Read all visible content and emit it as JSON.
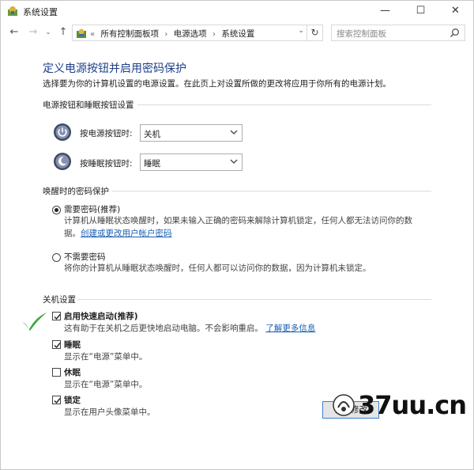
{
  "window": {
    "title": "系统设置",
    "controls": {
      "minimize": "—",
      "maximize": "☐",
      "close": "✕"
    }
  },
  "nav": {
    "back": "←",
    "forward": "→",
    "recent": "⌄",
    "up": "↑",
    "breadcrumb_prefix": "«",
    "breadcrumbs": [
      "所有控制面板项",
      "电源选项",
      "系统设置"
    ],
    "refresh": "↻",
    "search_placeholder": "搜索控制面板"
  },
  "page": {
    "title": "定义电源按钮并启用密码保护",
    "intro": "选择要为你的计算机设置的电源设置。在此页上对设置所做的更改将应用于你所有的电源计划。"
  },
  "power_buttons": {
    "group_title": "电源按钮和睡眠按钮设置",
    "power_button": {
      "label": "按电源按钮时:",
      "value": "关机"
    },
    "sleep_button": {
      "label": "按睡眠按钮时:",
      "value": "睡眠"
    }
  },
  "wake_password": {
    "group_title": "唤醒时的密码保护",
    "require": {
      "label": "需要密码(推荐)",
      "selected": true,
      "desc_line1": "计算机从睡眠状态唤醒时，如果未输入正确的密码来解除计算机锁定，任何人都无法访问你的数",
      "desc_line2": "据。",
      "link": "创建或更改用户帐户密码"
    },
    "not_require": {
      "label": "不需要密码",
      "selected": false,
      "desc": "将你的计算机从睡眠状态唤醒时，任何人都可以访问你的数据，因为计算机未锁定。"
    }
  },
  "shutdown": {
    "group_title": "关机设置",
    "fast_startup": {
      "label": "启用快速启动(推荐)",
      "checked": true,
      "desc": "这有助于在关机之后更快地启动电脑。不会影响重启。",
      "link": "了解更多信息"
    },
    "sleep": {
      "label": "睡眠",
      "checked": true,
      "desc": "显示在“电源”菜单中。"
    },
    "hibernate": {
      "label": "休眠",
      "checked": false,
      "desc": "显示在“电源”菜单中。"
    },
    "lock": {
      "label": "锁定",
      "checked": true,
      "desc": "显示在用户头像菜单中。"
    }
  },
  "footer": {
    "save_label": "保存修改",
    "watermark": "37uu.cn"
  },
  "colors": {
    "heading": "#1e3f8a",
    "link": "#1a5fb4",
    "check_green": "#3aa63a"
  }
}
